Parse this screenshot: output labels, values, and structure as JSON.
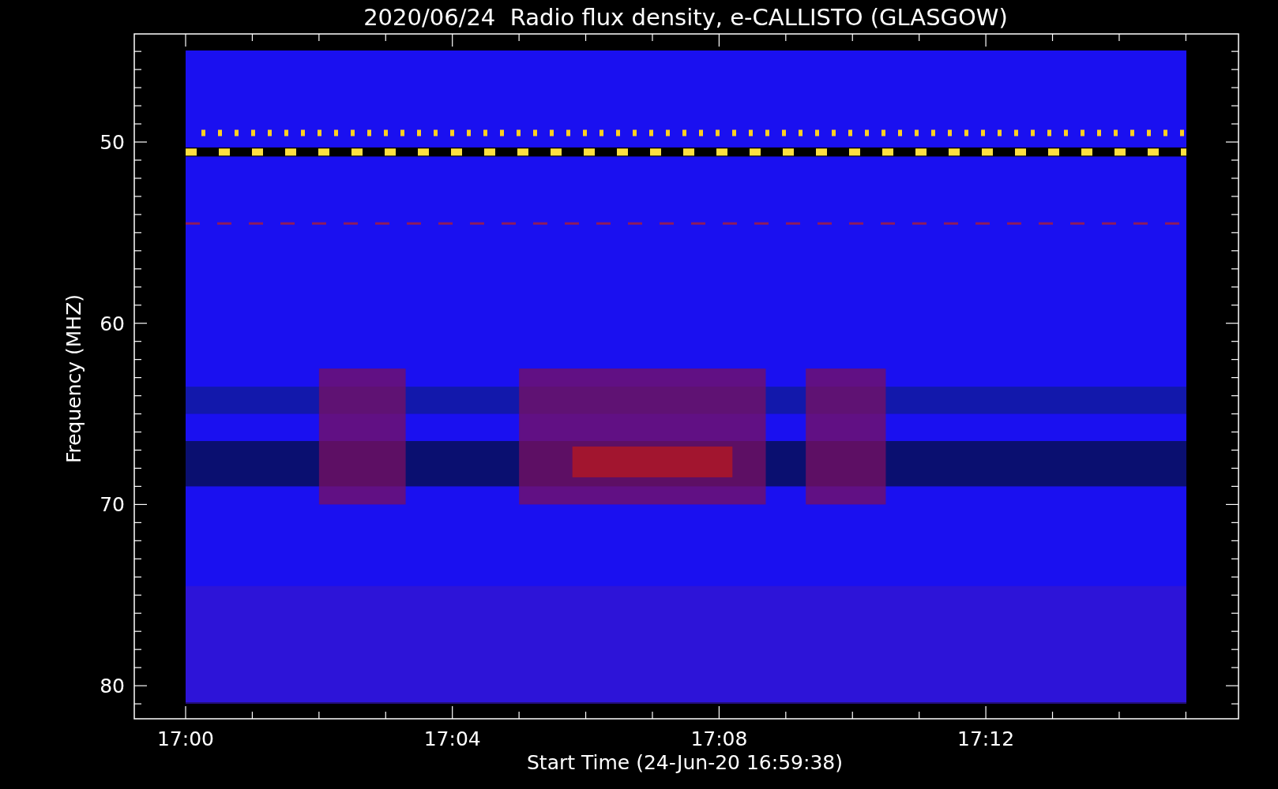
{
  "title": "2020/06/24  Radio flux density, e-CALLISTO (GLASGOW)",
  "y_axis": {
    "label": "Frequency (MHZ)",
    "ticks": [
      "50",
      "60",
      "70",
      "80"
    ]
  },
  "x_axis": {
    "label": "Start Time (24-Jun-20 16:59:38)",
    "ticks": [
      "17:00",
      "17:04",
      "17:08",
      "17:12"
    ]
  }
}
